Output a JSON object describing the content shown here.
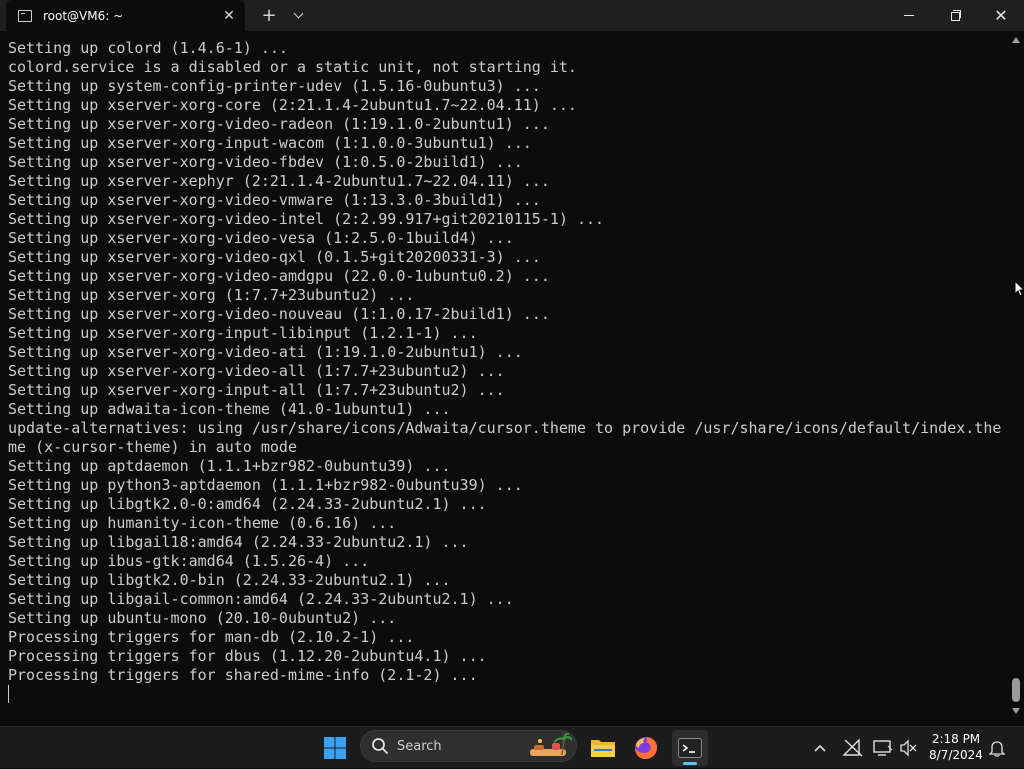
{
  "window": {
    "tab_title": "root@VM6: ~",
    "tab_icon": "terminal-tab-icon",
    "tab_close": "✕",
    "new_tab": "+",
    "close_glyph": "✕"
  },
  "terminal": {
    "lines": [
      "Setting up colord (1.4.6-1) ...",
      "colord.service is a disabled or a static unit, not starting it.",
      "Setting up system-config-printer-udev (1.5.16-0ubuntu3) ...",
      "Setting up xserver-xorg-core (2:21.1.4-2ubuntu1.7~22.04.11) ...",
      "Setting up xserver-xorg-video-radeon (1:19.1.0-2ubuntu1) ...",
      "Setting up xserver-xorg-input-wacom (1:1.0.0-3ubuntu1) ...",
      "Setting up xserver-xorg-video-fbdev (1:0.5.0-2build1) ...",
      "Setting up xserver-xephyr (2:21.1.4-2ubuntu1.7~22.04.11) ...",
      "Setting up xserver-xorg-video-vmware (1:13.3.0-3build1) ...",
      "Setting up xserver-xorg-video-intel (2:2.99.917+git20210115-1) ...",
      "Setting up xserver-xorg-video-vesa (1:2.5.0-1build4) ...",
      "Setting up xserver-xorg-video-qxl (0.1.5+git20200331-3) ...",
      "Setting up xserver-xorg-video-amdgpu (22.0.0-1ubuntu0.2) ...",
      "Setting up xserver-xorg (1:7.7+23ubuntu2) ...",
      "Setting up xserver-xorg-video-nouveau (1:1.0.17-2build1) ...",
      "Setting up xserver-xorg-input-libinput (1.2.1-1) ...",
      "Setting up xserver-xorg-video-ati (1:19.1.0-2ubuntu1) ...",
      "Setting up xserver-xorg-video-all (1:7.7+23ubuntu2) ...",
      "Setting up xserver-xorg-input-all (1:7.7+23ubuntu2) ...",
      "Setting up adwaita-icon-theme (41.0-1ubuntu1) ...",
      "update-alternatives: using /usr/share/icons/Adwaita/cursor.theme to provide /usr/share/icons/default/index.the",
      "me (x-cursor-theme) in auto mode",
      "Setting up aptdaemon (1.1.1+bzr982-0ubuntu39) ...",
      "Setting up python3-aptdaemon (1.1.1+bzr982-0ubuntu39) ...",
      "Setting up libgtk2.0-0:amd64 (2.24.33-2ubuntu2.1) ...",
      "Setting up humanity-icon-theme (0.6.16) ...",
      "Setting up libgail18:amd64 (2.24.33-2ubuntu2.1) ...",
      "Setting up ibus-gtk:amd64 (1.5.26-4) ...",
      "Setting up libgtk2.0-bin (2.24.33-2ubuntu2.1) ...",
      "Setting up libgail-common:amd64 (2.24.33-2ubuntu2.1) ...",
      "Setting up ubuntu-mono (20.10-0ubuntu2) ...",
      "Processing triggers for man-db (2.10.2-1) ...",
      "Processing triggers for dbus (1.12.20-2ubuntu4.1) ...",
      "Processing triggers for shared-mime-info (2.1-2) ..."
    ]
  },
  "taskbar": {
    "search_placeholder": "Search",
    "clock_time": "2:18 PM",
    "clock_date": "8/7/2024",
    "icons": [
      "windows-start-icon",
      "search-icon",
      "file-explorer-icon",
      "firefox-icon",
      "terminal-icon",
      "chevron-up-icon",
      "network-disconnected-icon",
      "display-icon",
      "volume-muted-icon",
      "notification-bell-icon"
    ]
  },
  "colors": {
    "terminal_bg": "#0c0c0c",
    "terminal_fg": "#cccccc",
    "titlebar_bg": "#1f1f1f",
    "taskbar_bg": "#1c1c1c",
    "accent": "#5cc6f2"
  }
}
